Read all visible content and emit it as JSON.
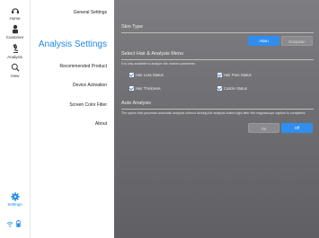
{
  "rail": {
    "items": [
      {
        "label": "Home",
        "icon": "home-icon"
      },
      {
        "label": "Customer",
        "icon": "customer-icon"
      },
      {
        "label": "Analysis",
        "icon": "microscope-icon"
      },
      {
        "label": "View",
        "icon": "search-icon"
      }
    ],
    "settings": {
      "label": "Settings",
      "icon": "gear-icon"
    },
    "status_icons": [
      "wifi-icon",
      "battery-icon"
    ],
    "accent": "#1e88e5"
  },
  "menu": {
    "items": [
      {
        "label": "General Settings"
      },
      {
        "label": "Analysis Settings",
        "active": true
      },
      {
        "label": "Recommended Product"
      },
      {
        "label": "Device Activation"
      },
      {
        "label": "Screen Color Filter"
      },
      {
        "label": "About"
      }
    ]
  },
  "panel": {
    "skin_type": {
      "title": "Skin Type",
      "options": [
        {
          "label": "Asian",
          "selected": true
        },
        {
          "label": "European",
          "selected": false
        }
      ]
    },
    "hair_menu": {
      "title": "Select Hair & Analysis Menu",
      "description": "It is only available to analyze the marked parameter.",
      "options": [
        {
          "label": "Hair Loss Status",
          "checked": true
        },
        {
          "label": "Hair Pore Status",
          "checked": true
        },
        {
          "label": "Hair Thickness",
          "checked": true
        },
        {
          "label": "Cuticle Status",
          "checked": true
        }
      ]
    },
    "auto_analysis": {
      "title": "Auto Analysis",
      "description": "The option that proceeds automatic analysis without clicking the analysis button right after the magnascope capture is completed.",
      "options": [
        {
          "label": "On",
          "selected": false
        },
        {
          "label": "Off",
          "selected": true
        }
      ]
    },
    "colors": {
      "selected": "#2f8ef0",
      "panel": "#737377"
    }
  }
}
